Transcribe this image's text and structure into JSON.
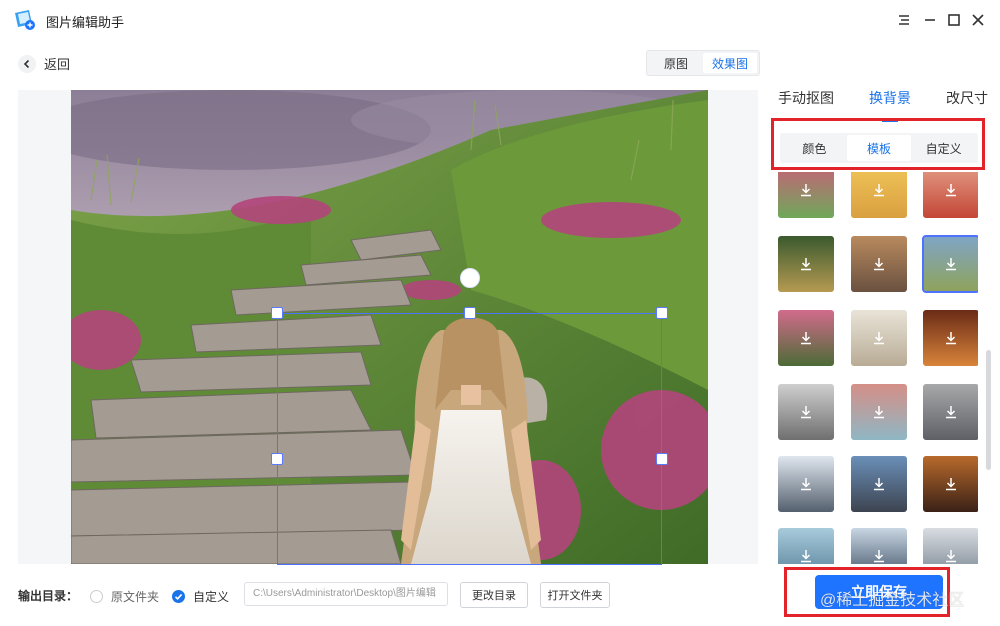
{
  "app": {
    "title": "图片编辑助手"
  },
  "nav": {
    "back_label": "返回"
  },
  "view_toggle": {
    "original": "原图",
    "effect": "效果图",
    "active": "effect"
  },
  "tabs": [
    {
      "label": "手动抠图",
      "active": false
    },
    {
      "label": "换背景",
      "active": true
    },
    {
      "label": "改尺寸",
      "active": false
    }
  ],
  "subtabs": [
    {
      "label": "颜色",
      "active": false
    },
    {
      "label": "模板",
      "active": true
    },
    {
      "label": "自定义",
      "active": false
    }
  ],
  "templates": [
    {
      "theme": "flower-field",
      "colors": [
        "#c95f7a",
        "#6fa85a"
      ]
    },
    {
      "theme": "wheat-field",
      "colors": [
        "#f1c65a",
        "#d9a040"
      ]
    },
    {
      "theme": "poppy-field",
      "colors": [
        "#e4a08a",
        "#c44636"
      ]
    },
    {
      "theme": "forest-path",
      "colors": [
        "#3b5a2e",
        "#b59a52"
      ]
    },
    {
      "theme": "autumn-path",
      "colors": [
        "#b98a5e",
        "#6a5140"
      ]
    },
    {
      "theme": "stone-stairs",
      "colors": [
        "#7fa5c7",
        "#8fa35a"
      ],
      "selected": true
    },
    {
      "theme": "flower-pot",
      "colors": [
        "#d26b8c",
        "#4c6b36"
      ]
    },
    {
      "theme": "white-arch",
      "colors": [
        "#e9e3d7",
        "#b8ac96"
      ]
    },
    {
      "theme": "theatre",
      "colors": [
        "#6a2b16",
        "#d9843a"
      ]
    },
    {
      "theme": "corridor",
      "colors": [
        "#cfcfcf",
        "#6f6f6f"
      ]
    },
    {
      "theme": "pink-room",
      "colors": [
        "#d58f87",
        "#8fb7c4"
      ]
    },
    {
      "theme": "museum-hall",
      "colors": [
        "#a8a8aa",
        "#5e6066"
      ]
    },
    {
      "theme": "palace-roof",
      "colors": [
        "#dfe6ee",
        "#54606e"
      ]
    },
    {
      "theme": "city-street",
      "colors": [
        "#6a8fb8",
        "#3d4450"
      ]
    },
    {
      "theme": "church-interior",
      "colors": [
        "#b86a2c",
        "#3a2116"
      ]
    },
    {
      "theme": "misty-mountain",
      "colors": [
        "#a9cbdc",
        "#4f7a93"
      ]
    },
    {
      "theme": "cloud-peak",
      "colors": [
        "#c9d6e3",
        "#34475c"
      ]
    },
    {
      "theme": "snow-village",
      "colors": [
        "#d9dde2",
        "#6d7b88"
      ]
    }
  ],
  "bottom": {
    "output_label": "输出目录：",
    "option_source": "原文件夹",
    "option_custom": "自定义",
    "selected_option": "custom",
    "path_value": "C:\\Users\\Administrator\\Desktop\\图片编辑",
    "change_dir": "更改目录",
    "open_folder": "打开文件夹",
    "save": "立即保存"
  },
  "watermark": "@稀土掘金技术社区",
  "colors": {
    "accent": "#1a73e8",
    "save_button": "#1f74ff",
    "highlight": "#e3232a"
  }
}
